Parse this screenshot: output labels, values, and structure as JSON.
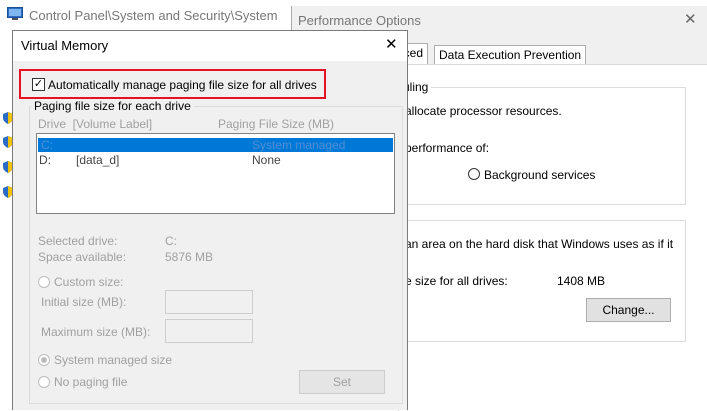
{
  "background": {
    "breadcrumb": "Control Panel\\System and Security\\System"
  },
  "perf": {
    "title": "Performance Options",
    "tabs": [
      {
        "label": "nced",
        "active": true
      },
      {
        "label": "Data Execution Prevention",
        "active": false
      }
    ],
    "scheduling_heading": "uling",
    "scheduling_text": "allocate processor resources.",
    "performance_of": "performance of:",
    "background_services": "Background services",
    "vm_text": "an area on the hard disk that Windows uses as if it",
    "total_label": "e size for all drives:",
    "total_value": "1408 MB",
    "change_button": "Change..."
  },
  "vm": {
    "title": "Virtual Memory",
    "auto_manage": {
      "label": "Automatically manage paging file size for all drives",
      "checked": true
    },
    "group_label": "Paging file size for each drive",
    "columns": {
      "drive": "Drive  [Volume Label]",
      "size": "Paging File Size (MB)"
    },
    "drives": [
      {
        "drive": "C:",
        "label": "",
        "size": "System managed",
        "selected": true
      },
      {
        "drive": "D:",
        "label": "[data_d]",
        "size": "None",
        "selected": false
      }
    ],
    "selected_drive_label": "Selected drive:",
    "selected_drive_value": "C:",
    "space_label": "Space available:",
    "space_value": "5876 MB",
    "custom_size": "Custom size:",
    "initial_size": "Initial size (MB):",
    "maximum_size": "Maximum size (MB):",
    "system_managed": "System managed size",
    "no_paging": "No paging file",
    "set_button": "Set"
  },
  "colors": {
    "accent": "#0078d7",
    "highlight": "#e81123"
  }
}
